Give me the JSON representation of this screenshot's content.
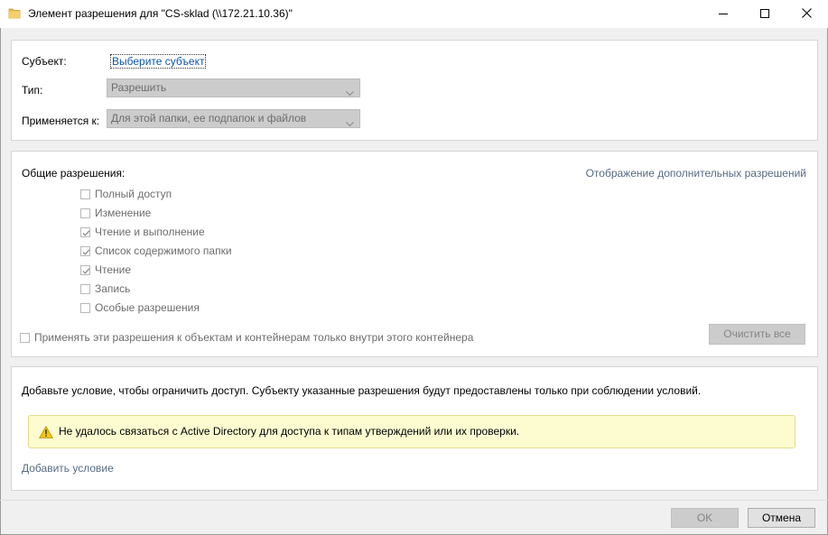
{
  "window": {
    "title": "Элемент разрешения для \"CS-sklad (\\\\172.21.10.36)\"",
    "controls": {
      "minimize": "minimize-icon",
      "maximize": "maximize-icon",
      "close": "close-icon"
    }
  },
  "principal_section": {
    "subject_label": "Субъект:",
    "subject_link": "Выберите субъект",
    "type_label": "Тип:",
    "type_value": "Разрешить",
    "applies_label": "Применяется к:",
    "applies_value": "Для этой папки, ее подпапок и файлов"
  },
  "permissions_section": {
    "heading": "Общие разрешения:",
    "advanced_link": "Отображение дополнительных разрешений",
    "items": [
      {
        "label": "Полный доступ",
        "checked": false
      },
      {
        "label": "Изменение",
        "checked": false
      },
      {
        "label": "Чтение и выполнение",
        "checked": true
      },
      {
        "label": "Список содержимого папки",
        "checked": true
      },
      {
        "label": "Чтение",
        "checked": true
      },
      {
        "label": "Запись",
        "checked": false
      },
      {
        "label": "Особые разрешения",
        "checked": false
      }
    ],
    "apply_inside_label": "Применять эти разрешения к объектам и контейнерам только внутри этого контейнера",
    "clear_all_label": "Очистить все"
  },
  "condition_section": {
    "description": "Добавьте условие, чтобы ограничить доступ. Субъекту указанные разрешения будут предоставлены только при соблюдении условий.",
    "warning_text": "Не удалось связаться с Active Directory для доступа к типам утверждений или их проверки.",
    "add_condition_link": "Добавить условие"
  },
  "footer": {
    "ok_label": "OK",
    "cancel_label": "Отмена"
  },
  "colors": {
    "accent_link": "#0b56b0",
    "disabled_fill": "#cccccc",
    "warning_bg": "#fdfbd0"
  }
}
